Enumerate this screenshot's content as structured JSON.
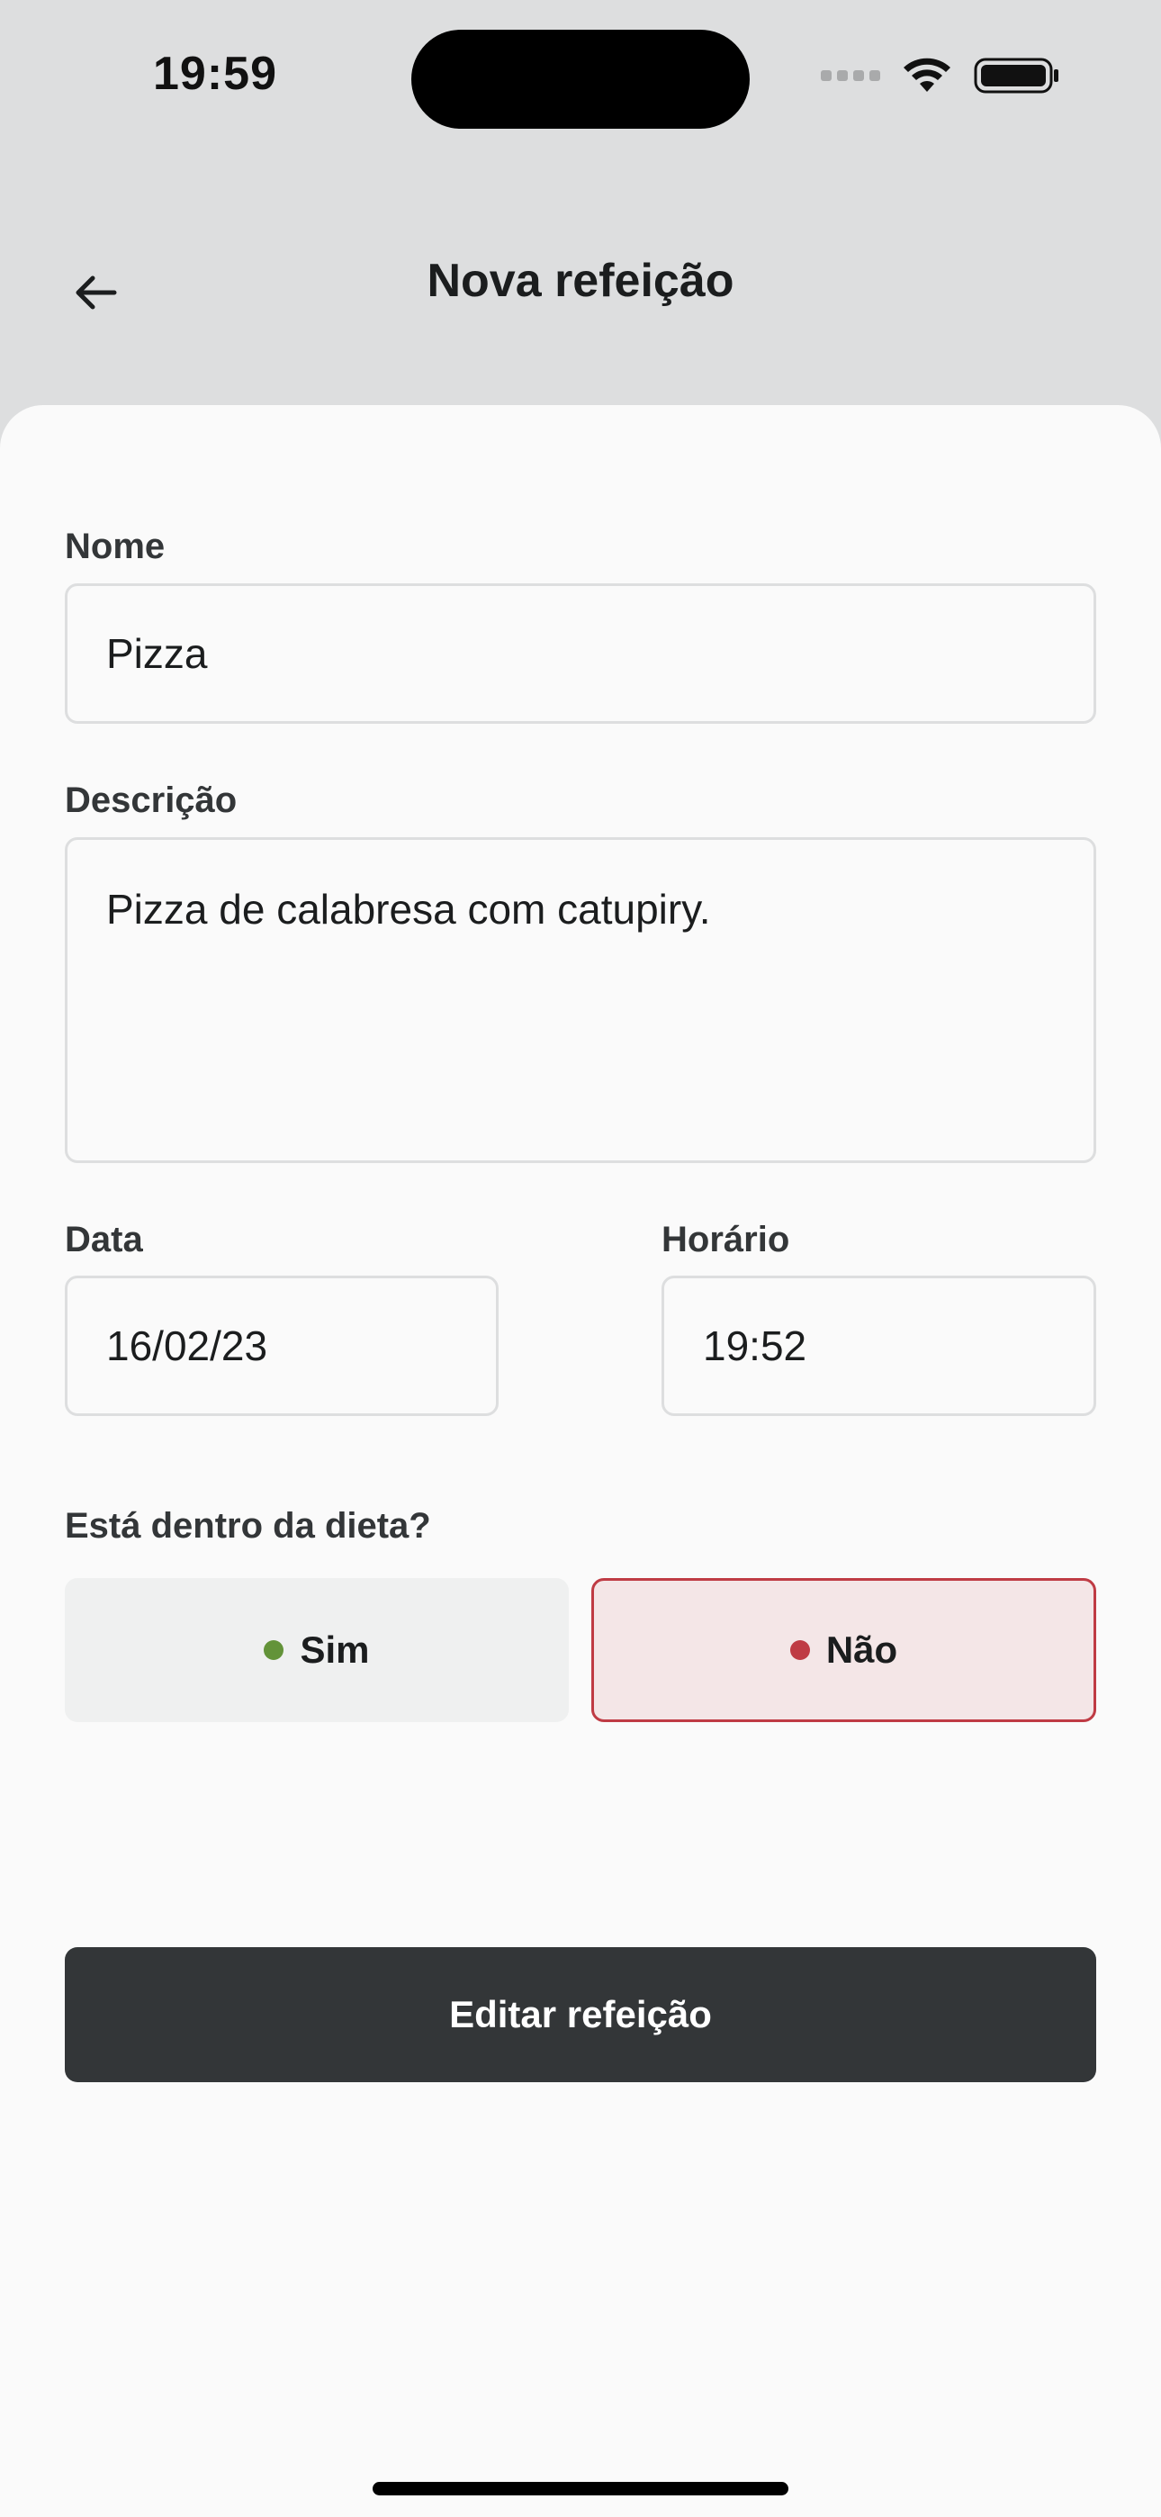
{
  "status_bar": {
    "time": "19:59"
  },
  "header": {
    "title": "Nova refeição",
    "back_icon": "arrow-left-icon"
  },
  "form": {
    "name": {
      "label": "Nome",
      "value": "Pizza"
    },
    "description": {
      "label": "Descrição",
      "value": "Pizza de calabresa com catupiry."
    },
    "date": {
      "label": "Data",
      "value": "16/02/23"
    },
    "time": {
      "label": "Horário",
      "value": "19:52"
    },
    "diet": {
      "label": "Está dentro da dieta?",
      "yes": {
        "label": "Sim",
        "dot_color": "#639339",
        "selected": false
      },
      "no": {
        "label": "Não",
        "dot_color": "#BF3B44",
        "selected": true
      }
    }
  },
  "submit": {
    "label": "Editar refeição"
  },
  "colors": {
    "primary": "#333638",
    "danger": "#BF3B44",
    "success": "#639339"
  }
}
